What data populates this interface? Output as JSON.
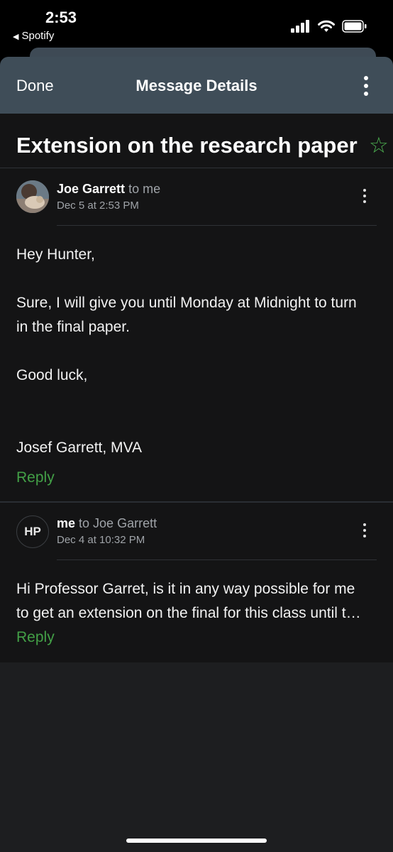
{
  "status_bar": {
    "time": "2:53",
    "back_app": "Spotify"
  },
  "nav": {
    "done_label": "Done",
    "title": "Message Details"
  },
  "subject": "Extension on the research paper",
  "messages": [
    {
      "sender": "Joe Garrett",
      "recipient": "to me",
      "date": "Dec 5 at 2:53 PM",
      "body": [
        "Hey Hunter,",
        "Sure, I will give you until Monday at Midnight to turn in the final paper.",
        "Good luck,",
        "Josef Garrett, MVA"
      ],
      "reply_label": "Reply"
    },
    {
      "avatar_initials": "HP",
      "sender": "me",
      "recipient": "to Joe Garrett",
      "date": "Dec 4 at 10:32 PM",
      "preview_line1": "Hi Professor Garret, is it in any way possible for me",
      "preview_line2": "to get an extension on the final for this class until t…",
      "reply_label": "Reply"
    }
  ],
  "colors": {
    "accent": "#43a047",
    "nav_bg": "#3f4d58",
    "bg": "#141415"
  }
}
